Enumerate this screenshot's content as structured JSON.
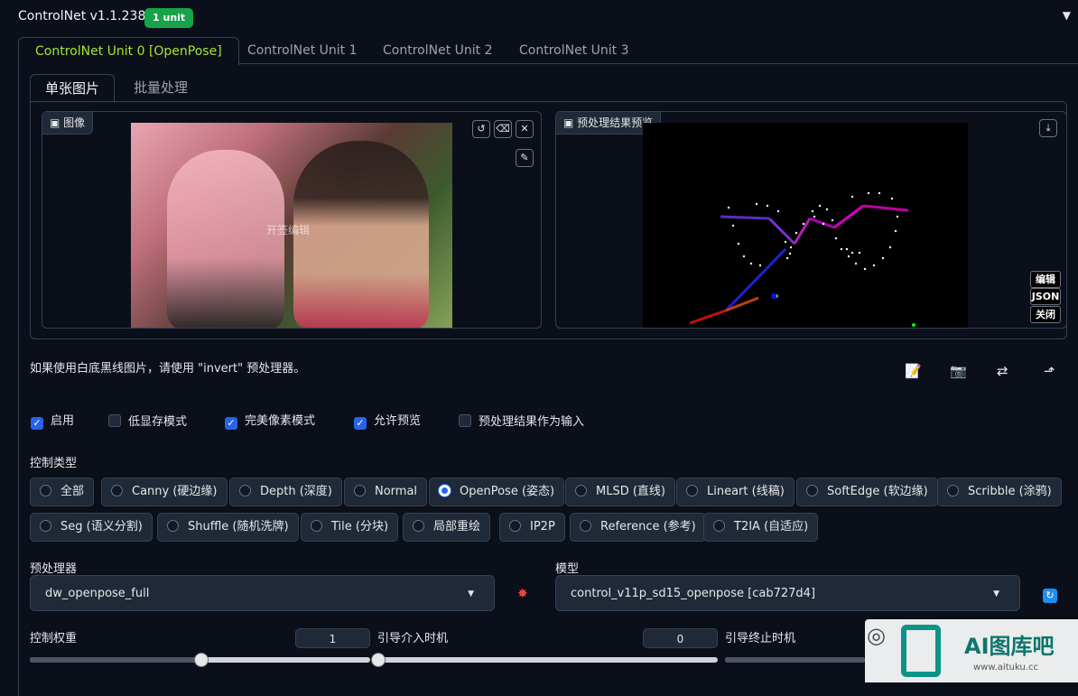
{
  "header": {
    "title": "ControlNet v1.1.238",
    "badge": "1 unit",
    "collapse_icon": "triangle-down-icon"
  },
  "unit_tabs": [
    "ControlNet Unit 0 [OpenPose]",
    "ControlNet Unit 1",
    "ControlNet Unit 2",
    "ControlNet Unit 3"
  ],
  "image_tabs": [
    "单张图片",
    "批量处理"
  ],
  "image_panel": {
    "label": "图像",
    "watermark_text": "开签编辑"
  },
  "preview_panel": {
    "label": "预处理结果预览",
    "buttons": [
      "编辑",
      "JSON",
      "关闭"
    ]
  },
  "hint": "如果使用白底黑线图片，请使用 \"invert\" 预处理器。",
  "checkboxes": [
    {
      "label": "启用",
      "checked": true
    },
    {
      "label": "低显存模式",
      "checked": false
    },
    {
      "label": "完美像素模式",
      "checked": true
    },
    {
      "label": "允许预览",
      "checked": true
    },
    {
      "label": "预处理结果作为输入",
      "checked": false
    }
  ],
  "control_type": {
    "label": "控制类型",
    "options": [
      "全部",
      "Canny (硬边缘)",
      "Depth (深度)",
      "Normal",
      "OpenPose (姿态)",
      "MLSD (直线)",
      "Lineart (线稿)",
      "SoftEdge (软边缘)",
      "Scribble (涂鸦)",
      "Seg (语义分割)",
      "Shuffle (随机洗牌)",
      "Tile (分块)",
      "局部重绘",
      "IP2P",
      "Reference (参考)",
      "T2IA (自适应)"
    ],
    "selected": "OpenPose (姿态)"
  },
  "preprocessor": {
    "label": "预处理器",
    "value": "dw_openpose_full"
  },
  "model": {
    "label": "模型",
    "value": "control_v11p_sd15_openpose [cab727d4]"
  },
  "weight": {
    "label": "控制权重",
    "value": "1",
    "fraction": 0.5
  },
  "guidance_start": {
    "label": "引导介入时机",
    "value": "0",
    "fraction": 0.0
  },
  "guidance_end": {
    "label": "引导终止时机",
    "fraction": 1.0
  },
  "watermark": {
    "text": "AI图库吧",
    "url": "www.aituku.cc"
  }
}
